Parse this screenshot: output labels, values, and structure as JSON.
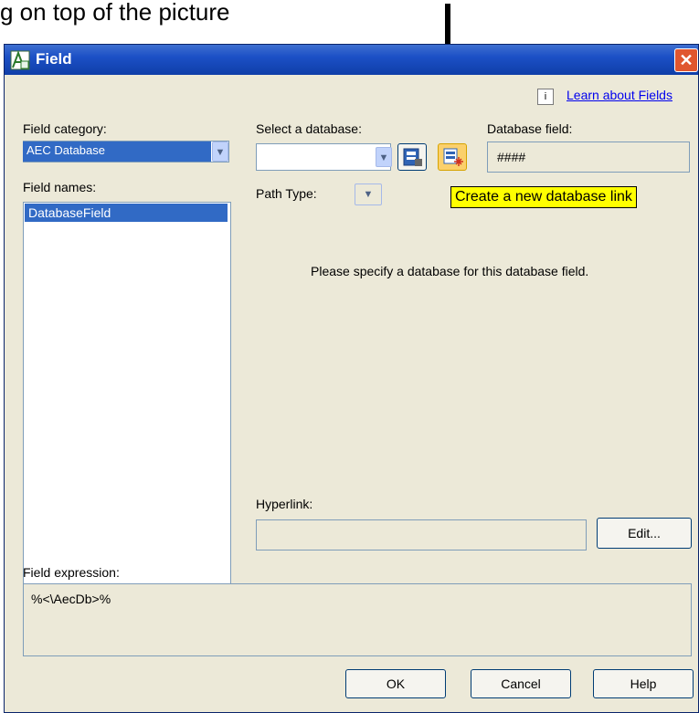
{
  "caption": "g on top of the picture",
  "dialog": {
    "title": "Field",
    "learn_link": "Learn about Fields",
    "learn_icon": "i",
    "field_category": {
      "label": "Field category:",
      "value": "AEC Database"
    },
    "field_names": {
      "label": "Field names:",
      "items": [
        "DatabaseField"
      ]
    },
    "select_database": {
      "label": "Select a database:",
      "value": ""
    },
    "database_field": {
      "label": "Database field:",
      "value": "####"
    },
    "path_type": {
      "label": "Path Type:"
    },
    "tooltip": "Create a new database link",
    "message": "Please specify a database for this database field.",
    "hyperlink": {
      "label": "Hyperlink:",
      "value": ""
    },
    "edit_button": "Edit...",
    "field_expression": {
      "label": "Field expression:",
      "value": "%<\\AecDb>%"
    },
    "buttons": {
      "ok": "OK",
      "cancel": "Cancel",
      "help": "Help"
    }
  },
  "colors": {
    "titlebar": "#1c50c6",
    "selection": "#316ac5",
    "tooltip": "#ffff00",
    "dialog_bg": "#ece9d8"
  }
}
